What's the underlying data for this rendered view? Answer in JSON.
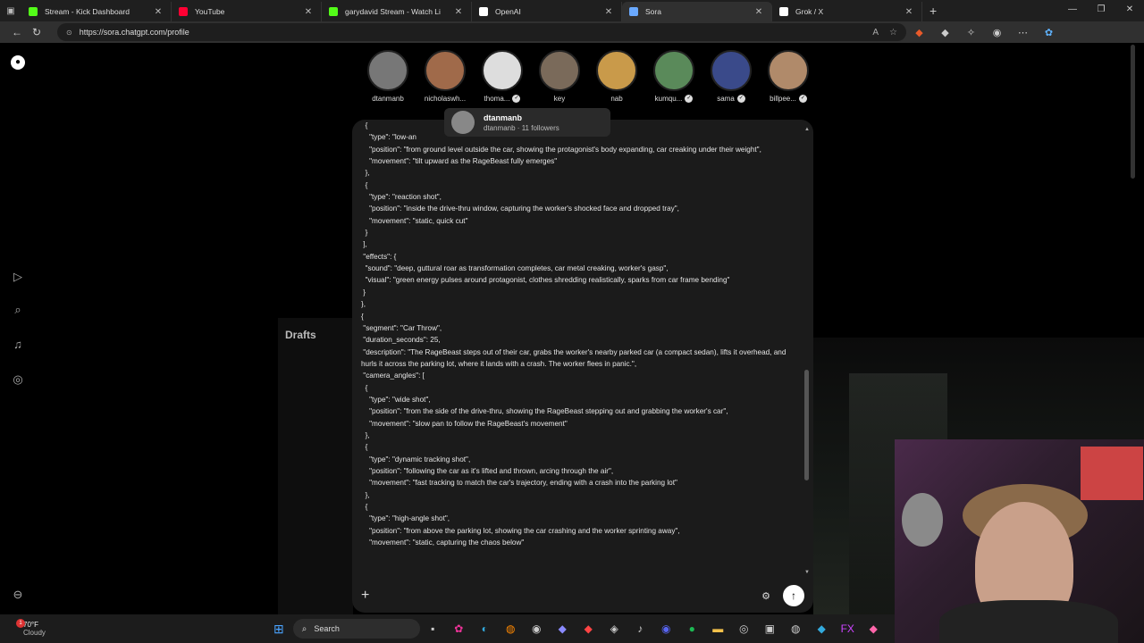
{
  "tabs": [
    {
      "title": "Stream - Kick Dashboard",
      "color": "#53fc18"
    },
    {
      "title": "YouTube",
      "color": "#ff0033"
    },
    {
      "title": "garydavid Stream - Watch Li",
      "color": "#53fc18"
    },
    {
      "title": "OpenAI",
      "color": "#ffffff"
    },
    {
      "title": "Sora",
      "color": "#6aa9ff"
    },
    {
      "title": "Grok / X",
      "color": "#ffffff"
    }
  ],
  "address": {
    "url": "https://sora.chatgpt.com/profile"
  },
  "avatars": [
    {
      "name": "dtanmanb",
      "verified": false,
      "color": "#777"
    },
    {
      "name": "nicholaswh...",
      "verified": false,
      "color": "#a06a4a"
    },
    {
      "name": "thoma...",
      "verified": true,
      "color": "#ddd"
    },
    {
      "name": "key",
      "verified": false,
      "color": "#7a6a5a"
    },
    {
      "name": "nab",
      "verified": false,
      "color": "#c99a4a"
    },
    {
      "name": "kumqu...",
      "verified": true,
      "color": "#5a8a5a"
    },
    {
      "name": "sama",
      "verified": true,
      "color": "#3a4a8a"
    },
    {
      "name": "billpee...",
      "verified": true,
      "color": "#b08a6a"
    }
  ],
  "hovercard": {
    "name": "dtanmanb",
    "subtitle": "dtanmanb · 11 followers"
  },
  "drafts": "Drafts",
  "prompt_text": "  {\n    \"type\": \"low-an\n    \"position\": \"from ground level outside the car, showing the protagonist's body expanding, car creaking under their weight\",\n    \"movement\": \"tilt upward as the RageBeast fully emerges\"\n  },\n  {\n    \"type\": \"reaction shot\",\n    \"position\": \"inside the drive-thru window, capturing the worker's shocked face and dropped tray\",\n    \"movement\": \"static, quick cut\"\n  }\n ],\n \"effects\": {\n  \"sound\": \"deep, guttural roar as transformation completes, car metal creaking, worker's gasp\",\n  \"visual\": \"green energy pulses around protagonist, clothes shredding realistically, sparks from car frame bending\"\n }\n},\n{\n \"segment\": \"Car Throw\",\n \"duration_seconds\": 25,\n \"description\": \"The RageBeast steps out of their car, grabs the worker's nearby parked car (a compact sedan), lifts it overhead, and hurls it across the parking lot, where it lands with a crash. The worker flees in panic.\",\n \"camera_angles\": [\n  {\n    \"type\": \"wide shot\",\n    \"position\": \"from the side of the drive-thru, showing the RageBeast stepping out and grabbing the worker's car\",\n    \"movement\": \"slow pan to follow the RageBeast's movement\"\n  },\n  {\n    \"type\": \"dynamic tracking shot\",\n    \"position\": \"following the car as it's lifted and thrown, arcing through the air\",\n    \"movement\": \"fast tracking to match the car's trajectory, ending with a crash into the parking lot\"\n  },\n  {\n    \"type\": \"high-angle shot\",\n    \"position\": \"from above the parking lot, showing the car crashing and the worker sprinting away\",\n    \"movement\": \"static, capturing the chaos below\"",
  "composer": {
    "plus": "+",
    "send": "↑"
  },
  "taskbar": {
    "temp": "70°F",
    "condition": "Cloudy",
    "badge": "1",
    "search": "Search"
  }
}
